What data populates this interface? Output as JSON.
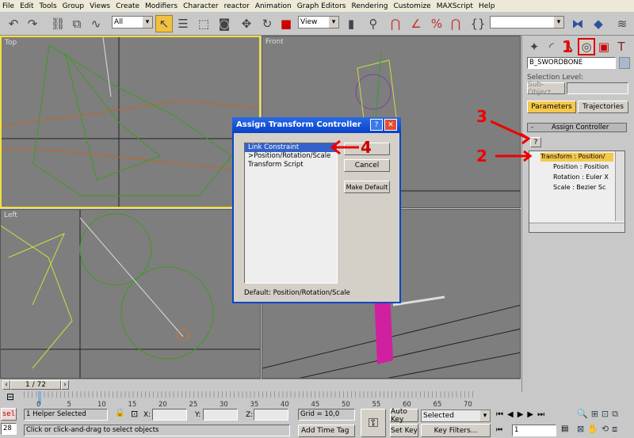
{
  "menu": [
    "File",
    "Edit",
    "Tools",
    "Group",
    "Views",
    "Create",
    "Modifiers",
    "Character",
    "reactor",
    "Animation",
    "Graph Editors",
    "Rendering",
    "Customize",
    "MAXScript",
    "Help"
  ],
  "toolbar": {
    "selection_filter": "All",
    "reference_coord": "View",
    "named_selection": ""
  },
  "viewports": [
    {
      "label": "Top",
      "active": true
    },
    {
      "label": "Front",
      "active": false
    },
    {
      "label": "Left",
      "active": false
    },
    {
      "label": "",
      "active": false
    }
  ],
  "panel": {
    "object_name": "B_SWORDBONE",
    "selection_level_label": "Selection Level:",
    "subobject_label": "Sub-Object",
    "parameters_label": "Parameters",
    "trajectories_label": "Trajectories",
    "rollout_title": "Assign Controller",
    "rollout_toggle": "-",
    "assign_button": "?",
    "tree": [
      "Transform : Position/",
      "Position : Position",
      "Rotation : Euler X",
      "Scale : Bezier Sc"
    ]
  },
  "annotations": [
    "1",
    "2",
    "3",
    "4"
  ],
  "dialog": {
    "title": "Assign Transform Controller",
    "help": "?",
    "close": "✕",
    "items": [
      "Link Constraint",
      ">Position/Rotation/Scale",
      "Transform Script"
    ],
    "ok_label": "",
    "cancel_label": "Cancel",
    "make_default_label": "Make Default",
    "default_text": "Default:  Position/Rotation/Scale"
  },
  "timeline": {
    "frame": "1 / 72",
    "ticks": [
      "0",
      "5",
      "10",
      "15",
      "20",
      "25",
      "30",
      "35",
      "40",
      "45",
      "50",
      "55",
      "60",
      "65",
      "70"
    ]
  },
  "status": {
    "script_label": "sel",
    "script_num": "28",
    "selection": "1 Helper Selected",
    "x_label": "X:",
    "y_label": "Y:",
    "z_label": "Z:",
    "grid": "Grid = 10,0",
    "prompt": "Click or click-and-drag to select objects",
    "add_time_tag": "Add Time Tag",
    "auto_key": "Auto Key",
    "set_key": "Set Key",
    "key_mode": "Selected",
    "key_filters": "Key Filters...",
    "current_frame": "1"
  }
}
